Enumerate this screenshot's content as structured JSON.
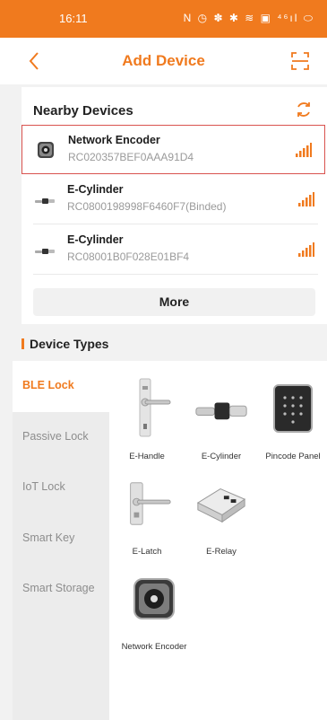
{
  "status": {
    "time": "16:11",
    "icons": "N ◷ ✽ ✱ ≋ ▣ ⁴⁶ıl ⬭"
  },
  "nav": {
    "title": "Add Device"
  },
  "nearby": {
    "title": "Nearby Devices",
    "devices": [
      {
        "name": "Network Encoder",
        "id": "RC020357BEF0AAA91D4"
      },
      {
        "name": "E-Cylinder",
        "id": "RC0800198998F6460F7(Binded)"
      },
      {
        "name": "E-Cylinder",
        "id": "RC08001B0F028E01BF4"
      }
    ],
    "more_label": "More"
  },
  "device_types": {
    "title": "Device Types",
    "categories": [
      "BLE Lock",
      "Passive Lock",
      "IoT Lock",
      "Smart Key",
      "Smart Storage"
    ],
    "items": [
      "E-Handle",
      "E-Cylinder",
      "Pincode Panel",
      "E-Latch",
      "E-Relay",
      "Network Encoder"
    ]
  },
  "colors": {
    "accent": "#f07a1e",
    "selected_border": "#d9534f"
  }
}
